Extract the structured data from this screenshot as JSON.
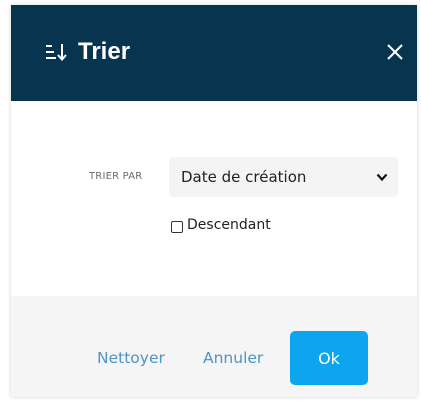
{
  "dialog": {
    "title": "Trier",
    "title_icon": "sort-descending-icon",
    "close_icon": "close-icon"
  },
  "sort": {
    "label": "TRIER PAR",
    "selected_option": "Date de création",
    "chevron_icon": "chevron-down-icon",
    "descending_label": "Descendant",
    "descending_checked": false
  },
  "footer": {
    "clear_label": "Nettoyer",
    "cancel_label": "Annuler",
    "ok_label": "Ok"
  },
  "colors": {
    "header_bg": "#07354f",
    "primary": "#0ea5f0",
    "link": "#4d95c5",
    "footer_bg": "#f5f5f5"
  }
}
